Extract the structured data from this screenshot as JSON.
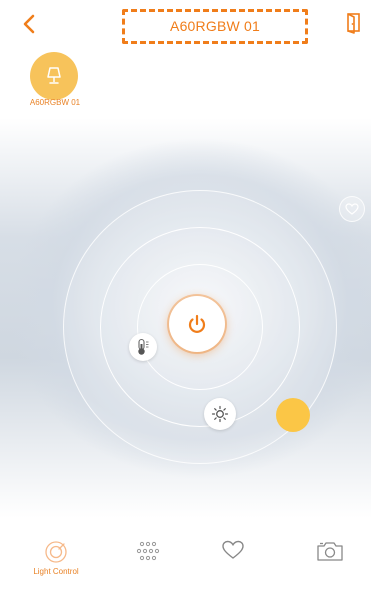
{
  "header": {
    "title": "A60RGBW 01",
    "back_icon": "chevron-left-icon",
    "exit_icon": "door-exit-icon"
  },
  "device": {
    "name": "A60RGBW 01",
    "icon": "lamp-icon"
  },
  "controls": {
    "power_icon": "power-icon",
    "temperature_icon": "thermometer-icon",
    "brightness_icon": "sun-icon",
    "favorite_icon": "heart-icon",
    "color_knob": "color-picker-knob"
  },
  "tabs": [
    {
      "label": "Light Control",
      "icon": "light-control-icon",
      "active": true
    },
    {
      "label": "",
      "icon": "scenes-dots-icon",
      "active": false
    },
    {
      "label": "",
      "icon": "heart-icon",
      "active": false
    },
    {
      "label": "",
      "icon": "camera-icon",
      "active": false
    }
  ],
  "colors": {
    "accent": "#f07d1a",
    "knob": "#fbc646",
    "thumb": "#f7c35b",
    "inactive_icon": "#9a9a9a"
  }
}
